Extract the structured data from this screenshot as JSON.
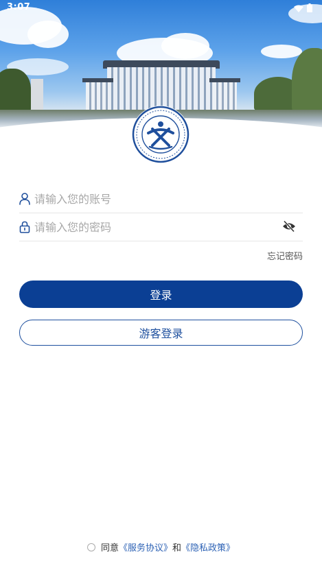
{
  "status_bar": {
    "time": "3:07",
    "wifi_icon": "wifi-icon",
    "battery_icon": "battery-icon"
  },
  "login": {
    "account_placeholder": "请输入您的账号",
    "password_placeholder": "请输入您的密码",
    "account_icon": "user-icon",
    "password_icon": "lock-icon",
    "toggle_icon": "eye-off-icon",
    "forgot_password": "忘记密码",
    "login_button": "登录",
    "guest_login_button": "游客登录"
  },
  "agreement": {
    "prefix": "同意",
    "service_agreement": "《服务协议》",
    "conjunction": "和",
    "privacy_policy": "《隐私政策》"
  },
  "colors": {
    "primary": "#0b3f94",
    "link": "#2d62b5",
    "placeholder": "#a8a8a8"
  }
}
